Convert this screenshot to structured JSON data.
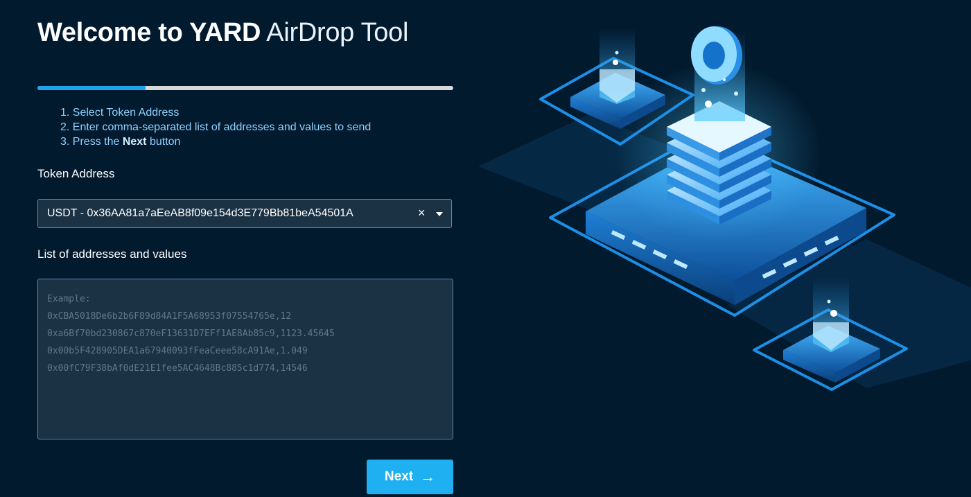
{
  "header": {
    "title_strong": "Welcome to YARD",
    "title_light": "AirDrop Tool"
  },
  "progress": {
    "value": 0.26
  },
  "steps": [
    {
      "text": "1. Select Token Address"
    },
    {
      "text": "2. Enter comma-separated list of addresses and values to send"
    },
    {
      "prefix": "3. Press the",
      "bold": "Next",
      "suffix": "button"
    }
  ],
  "token": {
    "label": "Token Address",
    "selected": "USDT - 0x36AA81a7aEeAB8f09e154d3E779Bb81beA54501A",
    "clear_icon": "×"
  },
  "addresses": {
    "label": "List of addresses and values",
    "placeholder": "Example:\n0xCBA5018De6b2b6F89d84A1F5A68953f07554765e,12\n0xa6Bf70bd230867c870eF13631D7EFf1AE8Ab85c9,1123.45645\n0x00b5F428905DEA1a67940093fFeaCeee58cA91Ae,1.049\n0x00fC79F38bAf0dE21E1fee5AC4648Bc885c1d774,14546",
    "value": ""
  },
  "actions": {
    "next_label": "Next",
    "next_icon": "→"
  },
  "colors": {
    "background": "#021a2e",
    "accent": "#1fb0f2",
    "progress_fill": "#1ea3ec",
    "step_text": "#8fd1ff"
  },
  "illustration": {
    "icon": "server-stack-illustration"
  }
}
